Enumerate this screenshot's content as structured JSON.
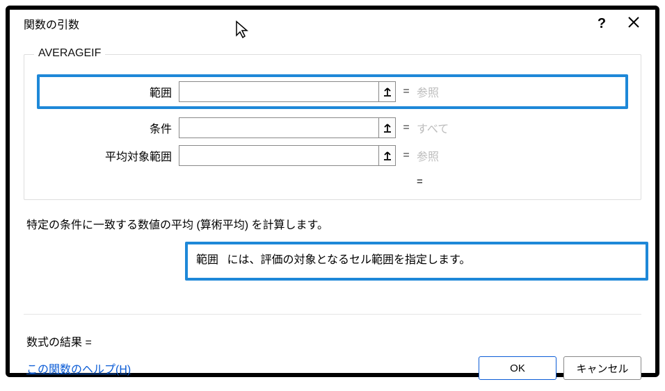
{
  "titlebar": {
    "title": "関数の引数",
    "help_label": "?",
    "close_label": "×"
  },
  "function": {
    "name": "AVERAGEIF",
    "args": [
      {
        "label": "範囲",
        "value": "",
        "hint": "参照",
        "highlighted": true
      },
      {
        "label": "条件",
        "value": "",
        "hint": "すべて",
        "highlighted": false
      },
      {
        "label": "平均対象範囲",
        "value": "",
        "hint": "参照",
        "highlighted": false
      }
    ],
    "result_eq": "="
  },
  "description": {
    "summary": "特定の条件に一致する数値の平均 (算術平均) を計算します。",
    "arg_name": "範囲",
    "arg_desc": "には、評価の対象となるセル範囲を指定します。"
  },
  "formula_result": {
    "label": "数式の結果 =",
    "value": ""
  },
  "footer": {
    "help": "この関数のヘルプ(H)",
    "ok": "OK",
    "cancel": "キャンセル"
  }
}
